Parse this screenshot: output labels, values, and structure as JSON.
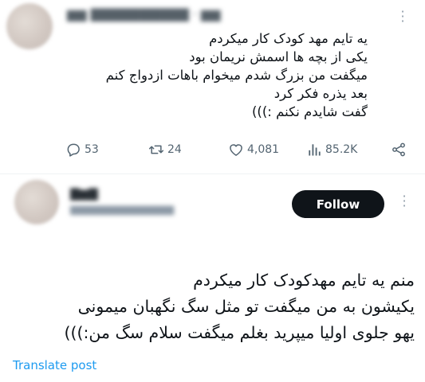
{
  "tweet1": {
    "text_lines": [
      "یه تایم مهد کودک کار میکردم",
      "یکی از بچه ها اسمش نریمان بود",
      "میگفت من بزرگ شدم میخوام باهات ازدواج کنم",
      "بعد یذره فکر کرد",
      "گفت شایدم نکنم :)))"
    ],
    "actions": {
      "replies": "53",
      "reposts": "24",
      "likes": "4,081",
      "views": "85.2K"
    }
  },
  "tweet2": {
    "follow_label": "Follow",
    "text_lines": [
      "منم یه تایم مهدکودک کار میکردم",
      "یکیشون به من میگفت تو مثل سگ نگهبان میمونی",
      "یهو جلوی اولیا میپرید بغلم میگفت سلام سگ من:)))"
    ],
    "translate_label": "Translate post"
  },
  "colors": {
    "follow_bg": "#0f1419",
    "link": "#1d9bf0",
    "muted": "#536471"
  }
}
